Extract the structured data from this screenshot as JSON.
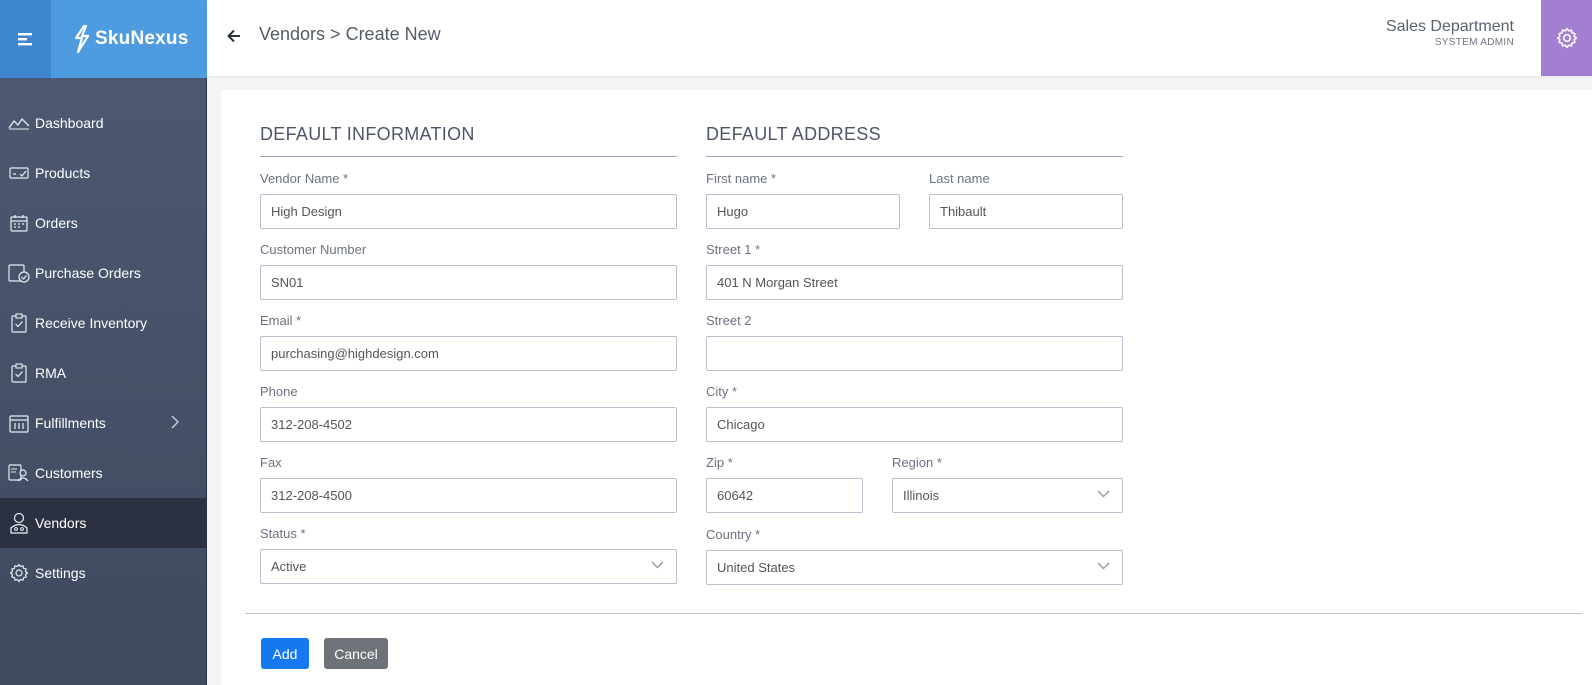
{
  "brand": {
    "name": "SkuNexus"
  },
  "sidebar": {
    "items": [
      {
        "label": "Dashboard",
        "icon": "dashboard-icon"
      },
      {
        "label": "Products",
        "icon": "products-icon"
      },
      {
        "label": "Orders",
        "icon": "orders-icon"
      },
      {
        "label": "Purchase Orders",
        "icon": "purchase-orders-icon"
      },
      {
        "label": "Receive Inventory",
        "icon": "clipboard-check-icon"
      },
      {
        "label": "RMA",
        "icon": "clipboard-check-icon"
      },
      {
        "label": "Fulfillments",
        "icon": "fulfillments-icon"
      },
      {
        "label": "Customers",
        "icon": "customers-icon"
      },
      {
        "label": "Vendors",
        "icon": "vendors-icon",
        "active": true
      },
      {
        "label": "Settings",
        "icon": "gear-icon"
      }
    ]
  },
  "header": {
    "breadcrumb": "Vendors > Create New",
    "department": "Sales Department",
    "role": "SYSTEM ADMIN"
  },
  "form": {
    "default_info": {
      "title": "DEFAULT INFORMATION",
      "vendor_name_label": "Vendor Name",
      "vendor_name": "High Design",
      "customer_number_label": "Customer Number",
      "customer_number": "SN01",
      "email_label": "Email",
      "email": "purchasing@highdesign.com",
      "phone_label": "Phone",
      "phone": "312-208-4502",
      "fax_label": "Fax",
      "fax": "312-208-4500",
      "status_label": "Status",
      "status": "Active"
    },
    "default_address": {
      "title": "DEFAULT ADDRESS",
      "first_name_label": "First name",
      "first_name": "Hugo",
      "last_name_label": "Last name",
      "last_name": "Thibault",
      "street1_label": "Street 1",
      "street1": "401 N Morgan Street",
      "street2_label": "Street 2",
      "street2": "",
      "city_label": "City",
      "city": "Chicago",
      "zip_label": "Zip",
      "zip": "60642",
      "region_label": "Region",
      "region": "Illinois",
      "country_label": "Country",
      "country": "United States"
    },
    "required_marker": "*"
  },
  "actions": {
    "add_label": "Add",
    "cancel_label": "Cancel"
  },
  "colors": {
    "brand_blue": "#4f9be0",
    "primary_button": "#1479f0",
    "settings_accent": "#a27fd1",
    "sidebar": "#4e5a73"
  }
}
